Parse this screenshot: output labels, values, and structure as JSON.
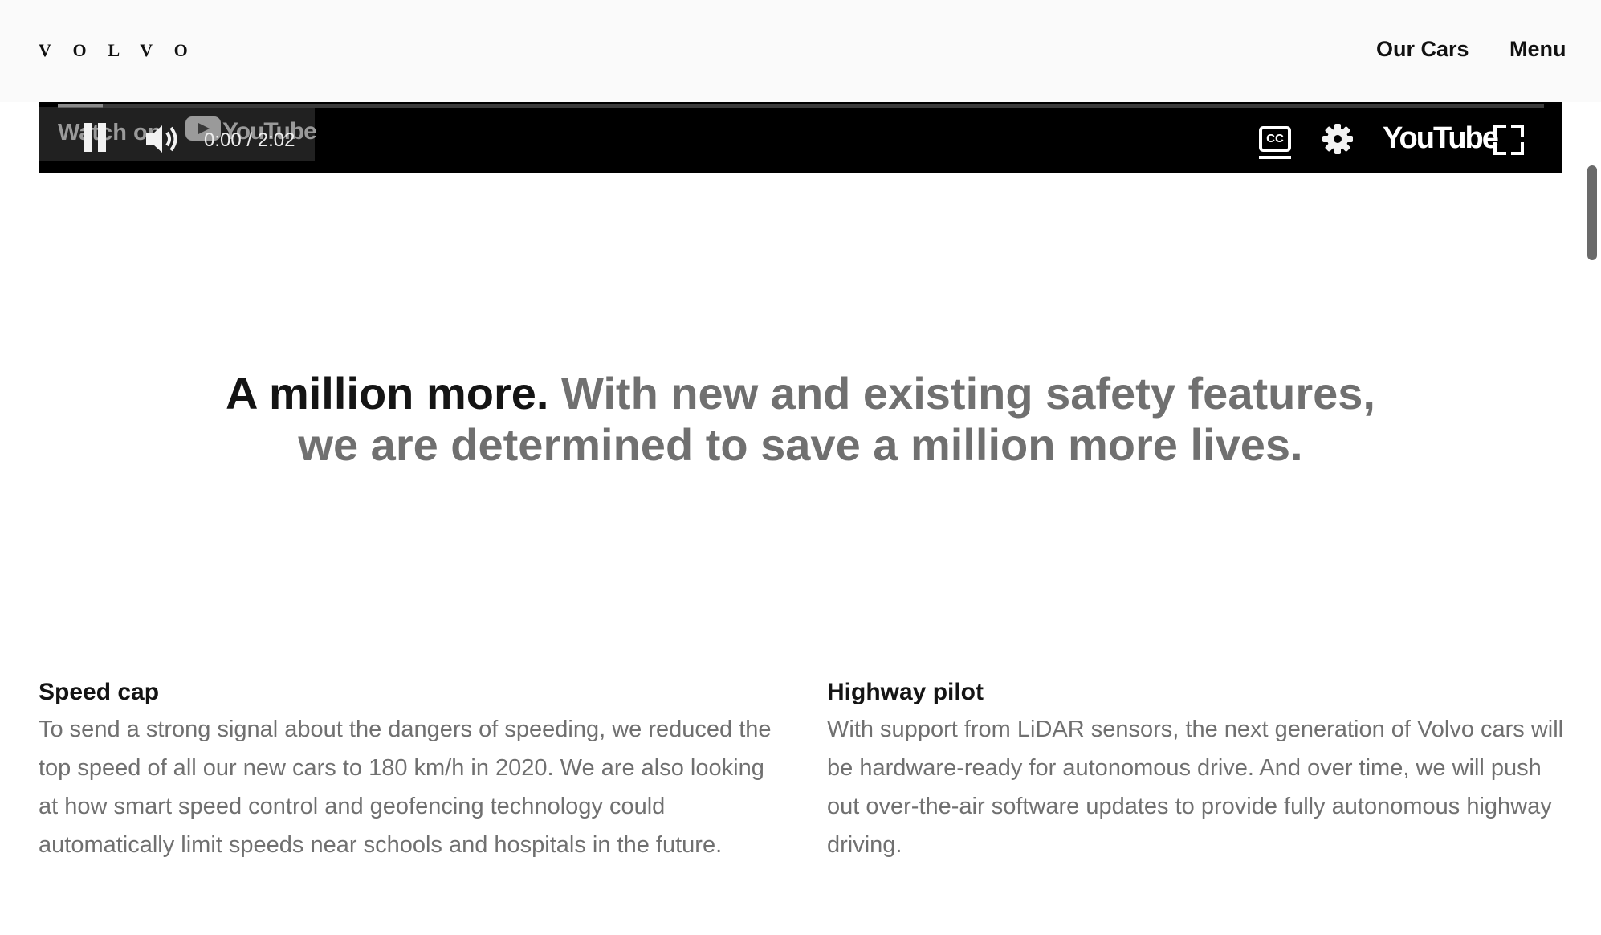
{
  "header": {
    "logo": "VOLVO",
    "nav": [
      "Our Cars",
      "Menu"
    ]
  },
  "video": {
    "watch_on": "Watch on",
    "watch_brand": "YouTube",
    "time": "0:00 / 2:02",
    "progress": 0.03,
    "cc_label": "CC",
    "brand": "YouTube"
  },
  "headline": {
    "lead": "A million more.",
    "rest_line1": "With new and existing safety features,",
    "rest_line2": "we are determined to save a million more lives."
  },
  "features": [
    {
      "title": "Speed cap",
      "body": "To send a strong signal about the dangers of speeding, we reduced the top speed of all our new cars to 180 km/h in 2020. We are also looking at how smart speed control and geofencing technology could automatically limit speeds near schools and hospitals in the future."
    },
    {
      "title": "Highway pilot",
      "body": "With support from LiDAR sensors, the next generation of Volvo cars will be hardware-ready for autonomous drive. And over time, we will push out over-the-air software updates to provide fully autonomous highway driving."
    }
  ],
  "colors": {
    "header_bg": "#fafafa",
    "text_dark": "#141414",
    "text_muted": "#707070",
    "player_bg": "#000000"
  }
}
